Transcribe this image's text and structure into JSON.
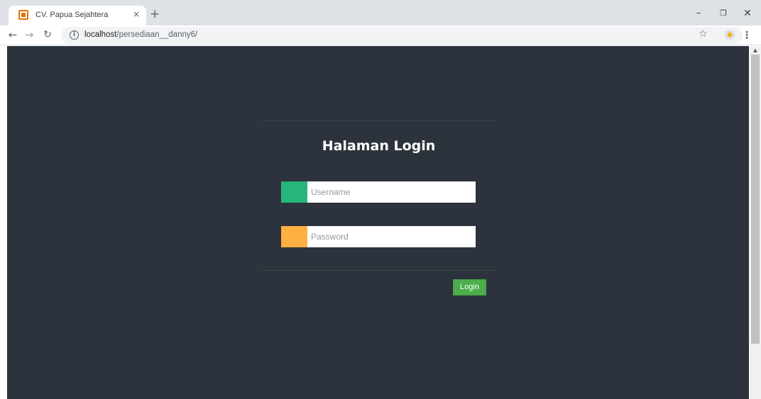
{
  "browser": {
    "tab_title": "CV. Papua Sejahtera",
    "tab_close": "×",
    "new_tab": "+",
    "url_host": "localhost",
    "url_path": "/persediaan__danny6/",
    "icons": [
      "favicon-icon",
      "close-icon",
      "plus-icon",
      "back-icon",
      "forward-icon",
      "reload-icon",
      "info-icon",
      "star-icon",
      "extension-icon",
      "menu-icon"
    ],
    "window_controls": {
      "minimize": "–",
      "restore": "❐",
      "close": "✕"
    }
  },
  "login": {
    "title": "Halaman Login",
    "username_placeholder": "Username",
    "password_placeholder": "Password",
    "submit_label": "Login"
  },
  "colors": {
    "page_background": "#2d333c",
    "username_addon": "#26b67b",
    "password_addon": "#ffb042",
    "login_button": "#4cae4c"
  }
}
